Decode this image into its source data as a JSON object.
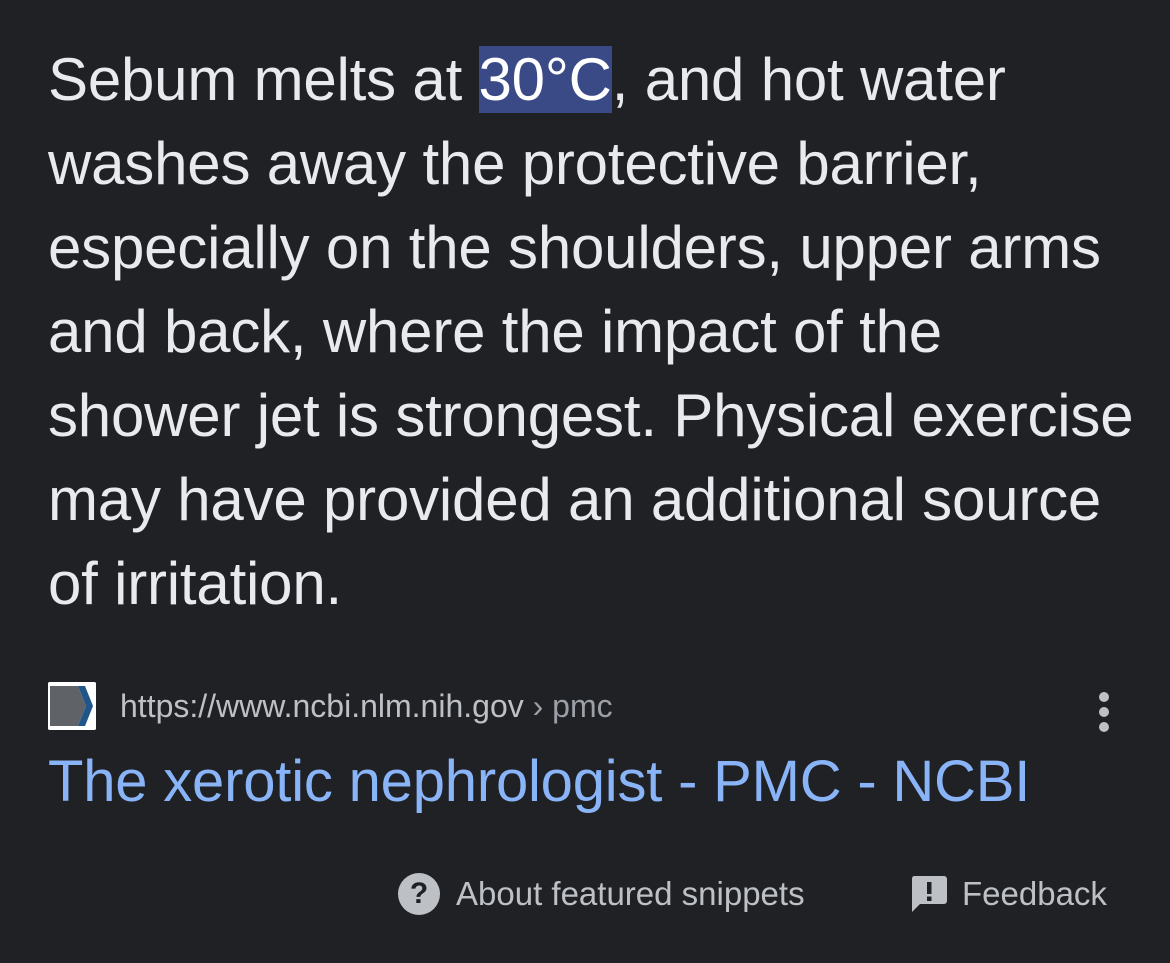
{
  "snippet": {
    "before": "Sebum melts at ",
    "highlight": "30°C",
    "after": ", and hot water washes away the protective barrier, especially on the shoulders, upper arms and back, where the impact of the shower jet is strongest. Physical exercise may have provided an additional source of irritation."
  },
  "source": {
    "url": "https://www.ncbi.nlm.nih.gov",
    "separator": " › ",
    "breadcrumb": "pmc",
    "favicon_icon": "ncbi-logo-icon",
    "more_icon": "more-vert-icon"
  },
  "result": {
    "title": "The xerotic nephrologist - PMC - NCBI",
    "link_color": "#8ab4f8"
  },
  "footer": {
    "about_icon": "help-icon",
    "about_label": "About featured snippets",
    "feedback_icon": "feedback-icon",
    "feedback_label": "Feedback"
  },
  "colors": {
    "background": "#202124",
    "text": "#e8eaed",
    "highlight_bg": "#3a4a86",
    "secondary_text": "#bdc1c6"
  }
}
